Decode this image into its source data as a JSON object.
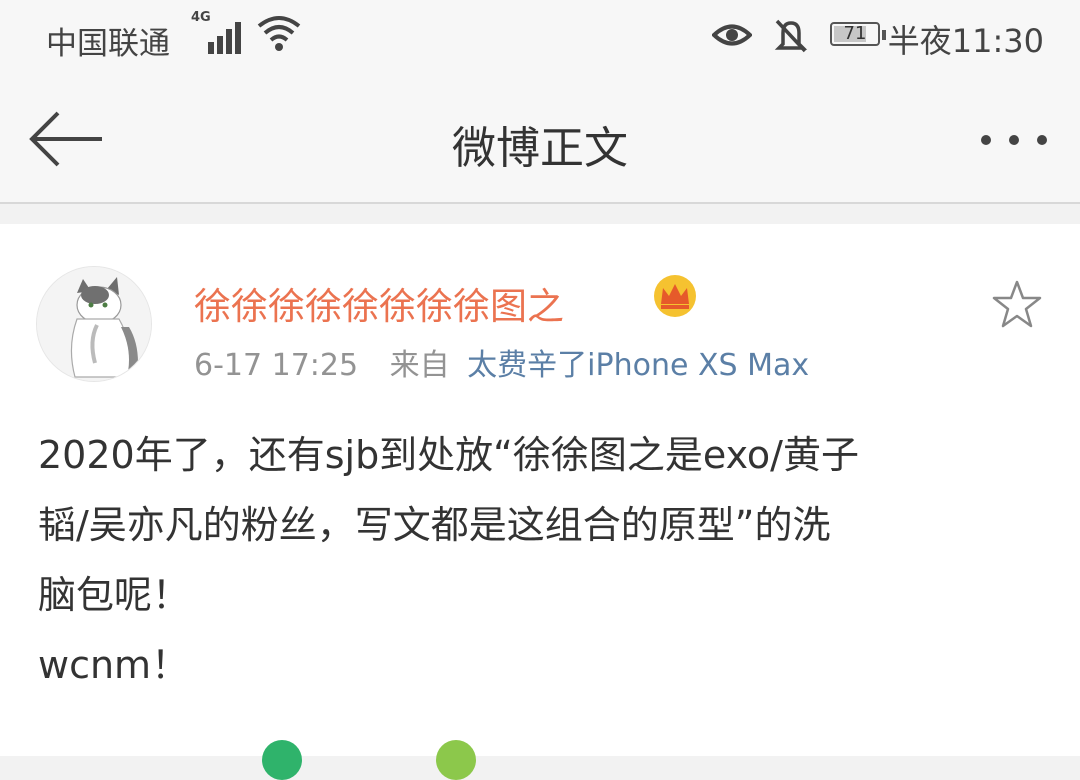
{
  "status_bar": {
    "carrier": "中国联通",
    "network_type": "4G",
    "battery": "71",
    "time": "半夜11:30",
    "icons": [
      "signal-icon",
      "wifi-icon",
      "eye-comfort-icon",
      "mute-bell-icon",
      "battery-icon"
    ]
  },
  "nav": {
    "title": "微博正文",
    "back_icon": "arrow-left-icon",
    "more_icon": "more-dots-icon"
  },
  "post": {
    "username": "徐徐徐徐徐徐徐徐图之",
    "badge_icon": "crown-icon",
    "time": "6-17 17:25",
    "from_label": "来自",
    "source": "太费辛了iPhone XS Max",
    "text_lines": [
      "2020年了，还有sjb到处放“徐徐图之是exo/黄子",
      "韬/吴亦凡的粉丝，写文都是这组合的原型”的洗",
      "脑包呢！",
      "wcnm！"
    ],
    "favorite_icon": "star-icon"
  },
  "colors": {
    "username": "#eb7350",
    "source_link": "#5b7fa6",
    "meta_gray": "#939393",
    "background": "#f2f2f2"
  }
}
